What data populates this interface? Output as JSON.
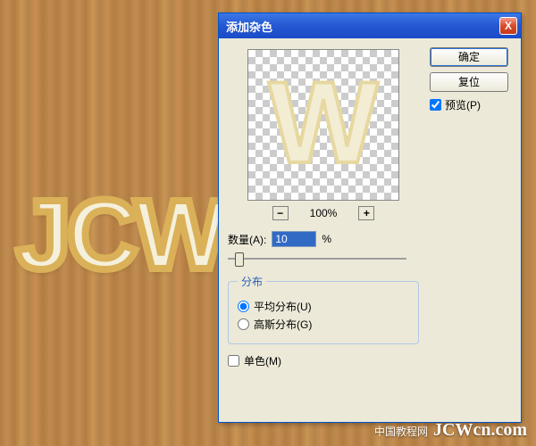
{
  "background_letters": "JCW",
  "dialog": {
    "title": "添加杂色",
    "close_glyph": "X",
    "ok_label": "确定",
    "reset_label": "复位",
    "preview_enabled": true,
    "preview_label": "预览(P)",
    "zoom_minus": "−",
    "zoom_value": "100%",
    "zoom_plus": "+",
    "amount_label": "数量(A):",
    "amount_value": "10",
    "amount_unit": "%",
    "slider_pos_percent": 4,
    "distribution": {
      "legend": "分布",
      "uniform_label": "平均分布(U)",
      "gaussian_label": "高斯分布(G)",
      "selected": "uniform"
    },
    "mono_label": "单色(M)",
    "mono_checked": false,
    "preview_letter": "W"
  },
  "watermark": {
    "small": "中国教程网",
    "main": "JCWcn.com"
  }
}
